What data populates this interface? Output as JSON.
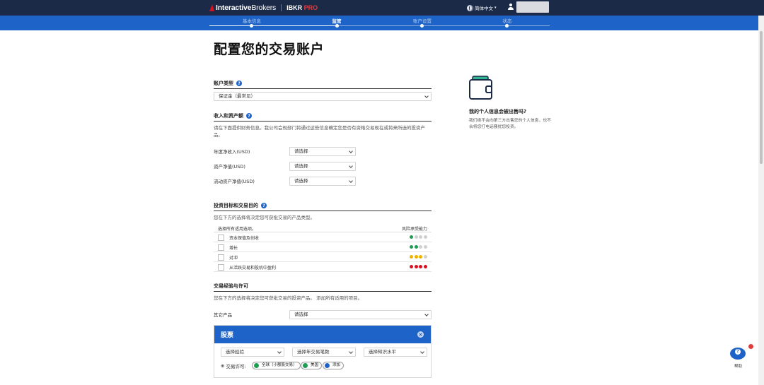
{
  "nav": {
    "brand": "InteractiveBrokers",
    "brand_bold": "Interactive",
    "brand_rest": "Brokers",
    "product": "IBKR",
    "product_accent": "PRO",
    "language": "简体中文"
  },
  "steps": [
    {
      "label": "基本信息",
      "state": "done"
    },
    {
      "label": "监管",
      "state": "active"
    },
    {
      "label": "账户设置",
      "state": "pending"
    },
    {
      "label": "状态",
      "state": "pending"
    }
  ],
  "page": {
    "title": "配置您的交易账户"
  },
  "account_type": {
    "label": "账户类型",
    "value": "保证金（最常见）"
  },
  "income": {
    "label": "收入和资产额",
    "description": "请在下面提供财务信息。我公司会规部门将通过这些信息确定您是否有资格交易现在或将来所选的投资产品。",
    "fields": [
      {
        "label": "年度净收入(USD)",
        "value": "请选择"
      },
      {
        "label": "资产净值(USD)",
        "value": "请选择"
      },
      {
        "label": "流动资产净值(USD)",
        "value": "请选择"
      }
    ]
  },
  "objectives": {
    "label": "投资目标和交易目的",
    "description": "您在下方的选择将决定您可获批交易的产品类型。",
    "col_left": "选择所有适用选项。",
    "col_right": "风险承受能力",
    "rows": [
      {
        "label": "资本保值及创收",
        "risk": 1
      },
      {
        "label": "增长",
        "risk": 2
      },
      {
        "label": "对冲",
        "risk": 3
      },
      {
        "label": "从活跃交易和投机中盈利",
        "risk": 4
      }
    ],
    "risk_colors": [
      "#1e9e52",
      "#1e9e52",
      "#f0b400",
      "#d81222"
    ]
  },
  "experience": {
    "label": "交易经验与许可",
    "description": "您在下方的选择将决定您可获批交易的投资产品。 添加所有适用的项目。",
    "other_products_label": "其它产品",
    "other_products_value": "请选择"
  },
  "stocks": {
    "title": "股票",
    "selects": [
      "选择经验",
      "选择年交易笔数",
      "选择知识水平"
    ],
    "permissions_label": "交易许可:",
    "chips": [
      "全球（小额股交易）",
      "美国",
      "添加"
    ]
  },
  "side": {
    "title": "我的个人信息会被出售吗?",
    "text": "我们绝不会向第三方出售您的个人信息，也不会将您打电话骚扰您投资。"
  },
  "help": {
    "label": "帮助"
  }
}
